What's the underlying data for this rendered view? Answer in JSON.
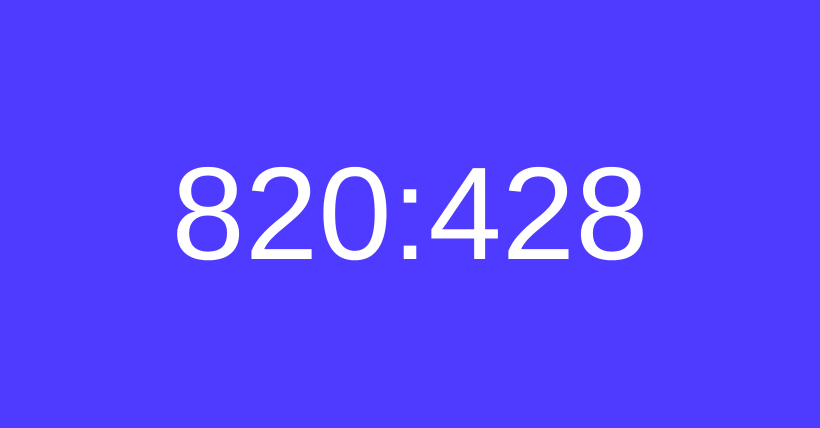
{
  "display": {
    "text": "820:428"
  },
  "colors": {
    "background": "#4f3bff",
    "text": "#ffffff"
  }
}
